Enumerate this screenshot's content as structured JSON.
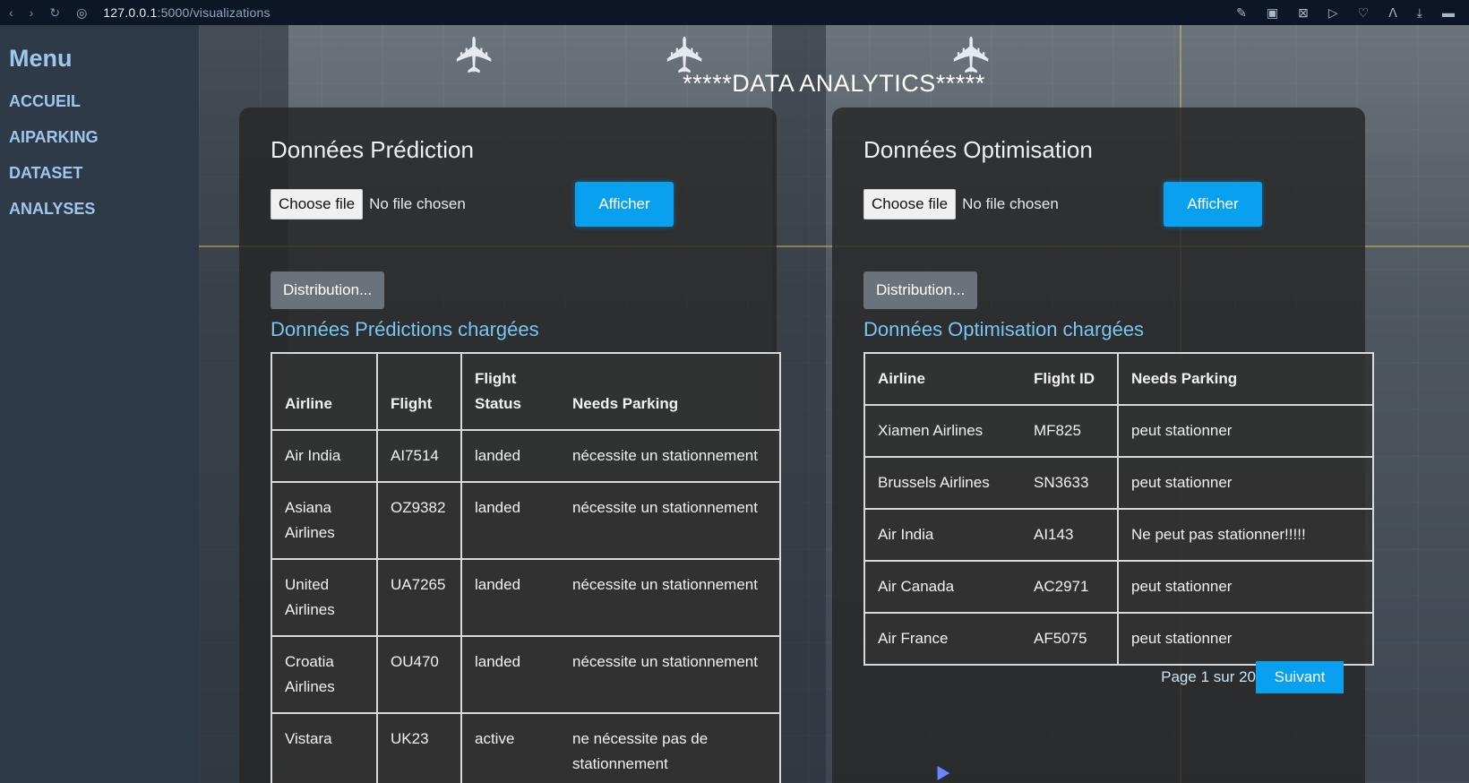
{
  "browser": {
    "url_host": "127.0.0.1",
    "url_port_path": ":5000/visualizations"
  },
  "sidebar": {
    "title": "Menu",
    "items": [
      {
        "label": "ACCUEIL"
      },
      {
        "label": "AIPARKING"
      },
      {
        "label": "DATASET"
      },
      {
        "label": "ANALYSES"
      }
    ]
  },
  "main": {
    "page_title": "*****DATA ANALYTICS*****"
  },
  "prediction": {
    "title": "Données Prédiction",
    "choose_file": "Choose file",
    "no_file": "No file chosen",
    "afficher": "Afficher",
    "distribution": "Distribution...",
    "loaded_title": "Données Prédictions chargées",
    "columns": [
      "Airline",
      "Flight",
      "Flight Status",
      "Needs Parking"
    ],
    "rows": [
      [
        "Air India",
        "AI7514",
        "landed",
        "nécessite un stationnement"
      ],
      [
        "Asiana Airlines",
        "OZ9382",
        "landed",
        "nécessite un stationnement"
      ],
      [
        "United Airlines",
        "UA7265",
        "landed",
        "nécessite un stationnement"
      ],
      [
        "Croatia Airlines",
        "OU470",
        "landed",
        "nécessite un stationnement"
      ],
      [
        "Vistara",
        "UK23",
        "active",
        "ne nécessite pas de stationnement"
      ]
    ]
  },
  "optimisation": {
    "title": "Données Optimisation",
    "choose_file": "Choose file",
    "no_file": "No file chosen",
    "afficher": "Afficher",
    "distribution": "Distribution...",
    "loaded_title": "Données Optimisation chargées",
    "columns": [
      "Airline",
      "Flight ID",
      "Needs Parking"
    ],
    "rows": [
      [
        "Xiamen Airlines",
        "MF825",
        "peut stationner"
      ],
      [
        "Brussels Airlines",
        "SN3633",
        "peut stationner"
      ],
      [
        "Air India",
        "AI143",
        "Ne peut pas stationner!!!!!"
      ],
      [
        "Air Canada",
        "AC2971",
        "peut stationner"
      ],
      [
        "Air France",
        "AF5075",
        "peut stationner"
      ]
    ],
    "pagination": {
      "info": "Page 1 sur 20",
      "next": "Suivant"
    }
  }
}
